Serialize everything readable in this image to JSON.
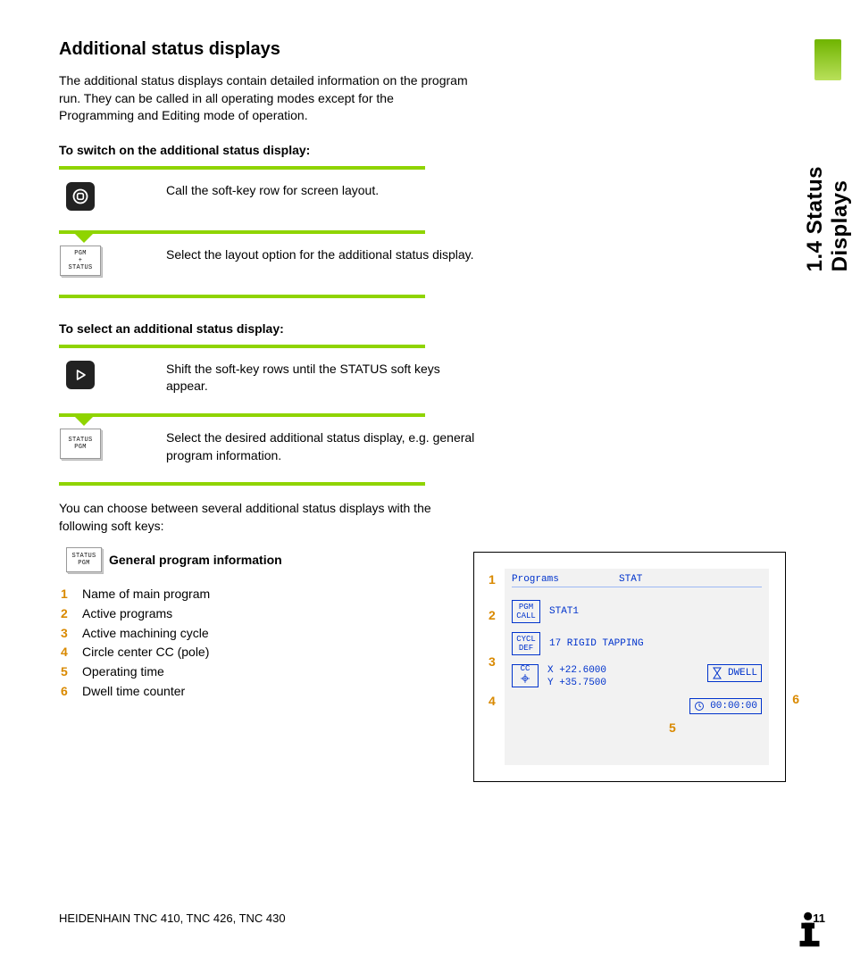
{
  "side_tab": "1.4 Status Displays",
  "heading": "Additional status displays",
  "intro": "The additional status displays contain detailed information on the program run. They can be called in all operating modes except for the Programming and Editing mode of operation.",
  "switch_on_head": "To switch on the additional status display:",
  "step1": "Call the soft-key row for screen layout.",
  "softkey1_l1": "PGM",
  "softkey1_l2": "+",
  "softkey1_l3": "STATUS",
  "step2": "Select the layout option for the additional status display.",
  "select_head": "To select an additional status display:",
  "step3": "Shift the soft-key rows until the STATUS soft keys appear.",
  "softkey2_l1": "STATUS",
  "softkey2_l2": "PGM",
  "step4": "Select the desired additional status display, e.g. general program information.",
  "after": "You can choose between several additional status displays with the following soft keys:",
  "gpi_key_l1": "STATUS",
  "gpi_key_l2": "PGM",
  "gpi_label": "General program information",
  "list": {
    "1": "Name of main program",
    "2": "Active programs",
    "3": "Active machining cycle",
    "4": "Circle center CC (pole)",
    "5": "Operating time",
    "6": "Dwell time counter"
  },
  "panel": {
    "title_left": "Programs",
    "title_right": "STAT",
    "pgmcall_l1": "PGM",
    "pgmcall_l2": "CALL",
    "pgmcall_val": "STAT1",
    "cycl_l1": "CYCL",
    "cycl_l2": "DEF",
    "cycl_val": "17  RIGID TAPPING",
    "cc_label": "CC",
    "cc_x": "X   +22.6000",
    "cc_y": "Y   +35.7500",
    "dwell_label": "DWELL",
    "time": "00:00:00"
  },
  "callouts": {
    "c1": "1",
    "c2": "2",
    "c3": "3",
    "c4": "4",
    "c5": "5",
    "c6": "6"
  },
  "footer_left": "HEIDENHAIN TNC 410, TNC 426, TNC 430",
  "footer_page": "11"
}
